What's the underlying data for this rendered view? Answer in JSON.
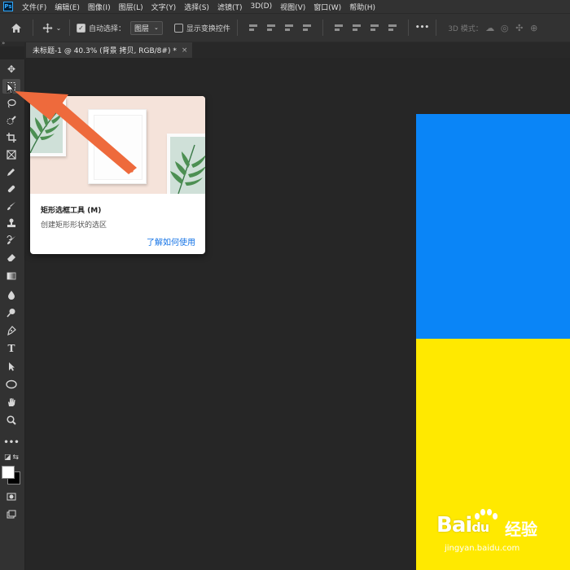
{
  "app": {
    "logo_text": "Ps"
  },
  "menu": [
    "文件(F)",
    "编辑(E)",
    "图像(I)",
    "图层(L)",
    "文字(Y)",
    "选择(S)",
    "滤镜(T)",
    "3D(D)",
    "视图(V)",
    "窗口(W)",
    "帮助(H)"
  ],
  "options": {
    "auto_select_label": "自动选择：",
    "auto_select_checked": true,
    "auto_select_target": "图层",
    "show_transform_label": "显示变换控件",
    "show_transform_checked": false,
    "more_label": "•••",
    "mode_3d_label": "3D 模式："
  },
  "document_tab": {
    "title": "未标题-1 @ 40.3% (背景 拷贝, RGB/8#) *",
    "close": "×"
  },
  "tooltip": {
    "title": "矩形选框工具 (M)",
    "description": "创建矩形形状的选区",
    "link": "了解如何使用"
  },
  "watermark": {
    "logo": "Bai",
    "logo_suffix": "du",
    "brand_cn": "经验",
    "url": "jingyan.baidu.com"
  },
  "canvas": {
    "top_color": "#0a85f7",
    "bottom_color": "#ffe900"
  },
  "annotation": {
    "arrow_color": "#ee6a3c"
  },
  "tools": [
    "move-tool",
    "rectangular-marquee-tool",
    "lasso-tool",
    "quick-selection-tool",
    "crop-tool",
    "frame-tool",
    "eyedropper-tool",
    "healing-brush-tool",
    "brush-tool",
    "clone-stamp-tool",
    "history-brush-tool",
    "eraser-tool",
    "gradient-tool",
    "blur-tool",
    "dodge-tool",
    "pen-tool",
    "type-tool",
    "path-selection-tool",
    "ellipse-tool",
    "hand-tool",
    "zoom-tool",
    "more-tools",
    "default-colors",
    "swap-colors",
    "quick-mask",
    "screen-mode"
  ]
}
